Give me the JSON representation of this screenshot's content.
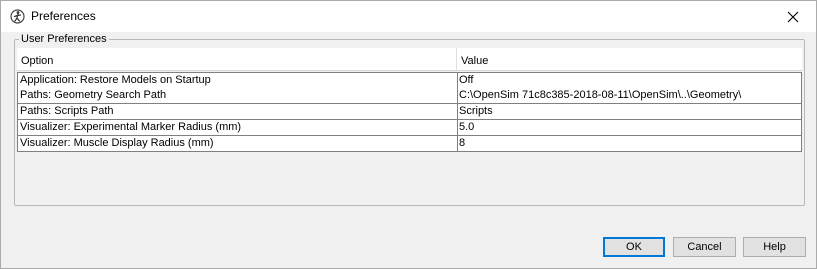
{
  "window": {
    "title": "Preferences"
  },
  "group": {
    "title": "User Preferences"
  },
  "table": {
    "headers": [
      "Option",
      "Value"
    ],
    "rows": [
      {
        "option": "Application: Restore Models on Startup",
        "value": "Off"
      },
      {
        "option": "Paths: Geometry Search Path",
        "value": "C:\\OpenSim 71c8c385-2018-08-11\\OpenSim\\..\\Geometry\\"
      },
      {
        "option": "Paths: Scripts Path",
        "value": "Scripts"
      },
      {
        "option": "Visualizer: Experimental Marker Radius (mm)",
        "value": "5.0"
      },
      {
        "option": "Visualizer: Muscle Display Radius (mm)",
        "value": "8"
      }
    ]
  },
  "buttons": {
    "ok": "OK",
    "cancel": "Cancel",
    "help": "Help"
  },
  "icons": {
    "app": "opensim-app-icon",
    "close": "close-icon"
  }
}
